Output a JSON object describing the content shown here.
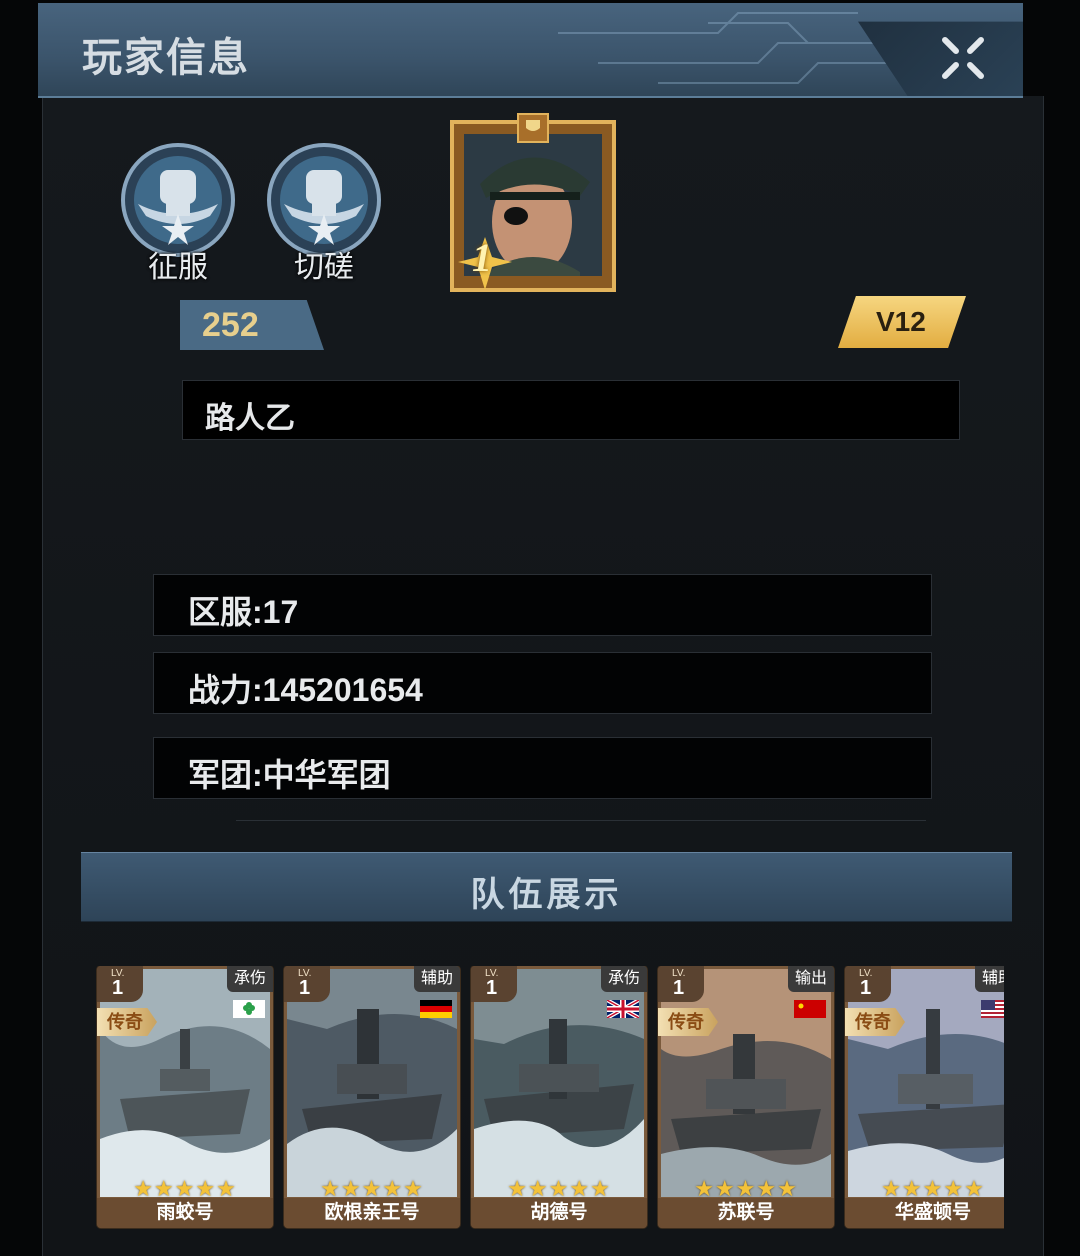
{
  "header": {
    "title": "玩家信息"
  },
  "modes": [
    {
      "label": "征服"
    },
    {
      "label": "切磋"
    }
  ],
  "player": {
    "level": "252",
    "vip": "V12",
    "name": "路人乙",
    "rank_badge": "1"
  },
  "info": {
    "server": "区服:17",
    "power": "战力:145201654",
    "legion": "军团:中华军团"
  },
  "team": {
    "title": "队伍展示",
    "cards": [
      {
        "lv_label": "LV.",
        "lv": "1",
        "role": "承伤",
        "rarity": "传奇",
        "flag": "green-clover-flag-icon",
        "stars": "★★★★★",
        "name": "雨蛟号"
      },
      {
        "lv_label": "LV.",
        "lv": "1",
        "role": "辅助",
        "rarity": "",
        "flag": "germany-flag-icon",
        "stars": "★★★★★",
        "name": "欧根亲王号"
      },
      {
        "lv_label": "LV.",
        "lv": "1",
        "role": "承伤",
        "rarity": "",
        "flag": "uk-flag-icon",
        "stars": "★★★★★",
        "name": "胡德号"
      },
      {
        "lv_label": "LV.",
        "lv": "1",
        "role": "输出",
        "rarity": "传奇",
        "flag": "soviet-flag-icon",
        "stars": "★★★★★",
        "name": "苏联号"
      },
      {
        "lv_label": "LV.",
        "lv": "1",
        "role": "辅助",
        "rarity": "传奇",
        "flag": "usa-flag-icon",
        "stars": "★★★★★",
        "name": "华盛顿号"
      }
    ]
  },
  "colors": {
    "accent_gold": "#e7cf8d",
    "header_blue": "#3b546b",
    "card_bronze": "#7a5a3c"
  }
}
